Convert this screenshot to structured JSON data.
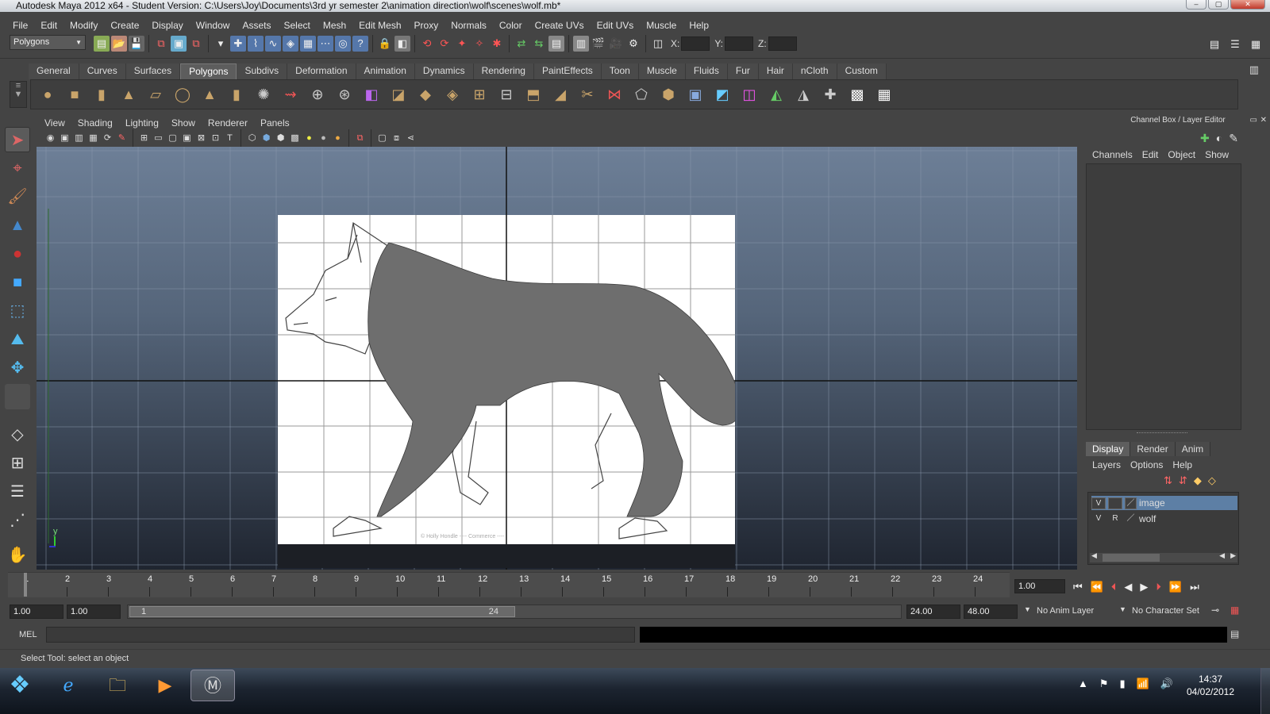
{
  "window": {
    "title": "Autodesk Maya 2012 x64 - Student Version: C:\\Users\\Joy\\Documents\\3rd yr semester 2\\animation direction\\wolf\\scenes\\wolf.mb*",
    "buttons": [
      "–",
      "▢",
      "✕"
    ]
  },
  "menubar": [
    "File",
    "Edit",
    "Modify",
    "Create",
    "Display",
    "Window",
    "Assets",
    "Select",
    "Mesh",
    "Edit Mesh",
    "Proxy",
    "Normals",
    "Color",
    "Create UVs",
    "Edit UVs",
    "Muscle",
    "Help"
  ],
  "statusline": {
    "mode": "Polygons",
    "x_label": "X:",
    "y_label": "Y:",
    "z_label": "Z:"
  },
  "shelf_tabs": [
    "General",
    "Curves",
    "Surfaces",
    "Polygons",
    "Subdivs",
    "Deformation",
    "Animation",
    "Dynamics",
    "Rendering",
    "PaintEffects",
    "Toon",
    "Muscle",
    "Fluids",
    "Fur",
    "Hair",
    "nCloth",
    "Custom"
  ],
  "active_shelf": "Polygons",
  "shelf_icons": [
    "poly-sphere",
    "poly-cube",
    "poly-cylinder",
    "poly-cone",
    "poly-plane",
    "poly-torus",
    "poly-pyramid",
    "poly-pipe",
    "soccer-ball",
    "combine",
    "separate",
    "extract",
    "smooth",
    "bridge",
    "append",
    "split",
    "insert-edge-loop",
    "offset-loop",
    "extrude",
    "wedge",
    "cut",
    "merge",
    "subdiv",
    "bevel",
    "sculpt",
    "uv-editor",
    "map-planar",
    "map-cylindrical",
    "map-spherical",
    "map-auto",
    "checker",
    "checker-map"
  ],
  "panel": {
    "menus": [
      "View",
      "Shading",
      "Lighting",
      "Show",
      "Renderer",
      "Panels"
    ],
    "axis_y": "y",
    "axis_x": "x",
    "camera": "side"
  },
  "channel_box": {
    "title": "Channel Box / Layer Editor",
    "menus": [
      "Channels",
      "Edit",
      "Object",
      "Show"
    ]
  },
  "layer_editor": {
    "tabs": [
      "Display",
      "Render",
      "Anim"
    ],
    "active_tab": "Display",
    "menus": [
      "Layers",
      "Options",
      "Help"
    ],
    "layers": [
      {
        "v": "V",
        "r": "",
        "name": "image",
        "selected": true
      },
      {
        "v": "V",
        "r": "R",
        "name": "wolf",
        "selected": false
      }
    ]
  },
  "timeline": {
    "frames": [
      "1",
      "2",
      "3",
      "4",
      "5",
      "6",
      "7",
      "8",
      "9",
      "10",
      "11",
      "12",
      "13",
      "14",
      "15",
      "16",
      "17",
      "18",
      "19",
      "20",
      "21",
      "22",
      "23",
      "24"
    ],
    "current": "1.00"
  },
  "range": {
    "start": "1.00",
    "anim_start": "1.00",
    "slider_start": "1",
    "slider_end": "24",
    "anim_end": "24.00",
    "end": "48.00",
    "anim_layer": "No Anim Layer",
    "character": "No Character Set"
  },
  "mel": {
    "label": "MEL",
    "value": ""
  },
  "help_line": "Select Tool: select an object",
  "taskbar": {
    "time": "14:37",
    "date": "04/02/2012",
    "apps": [
      "windows-start",
      "internet-explorer",
      "file-explorer",
      "media-player",
      "maya"
    ]
  }
}
